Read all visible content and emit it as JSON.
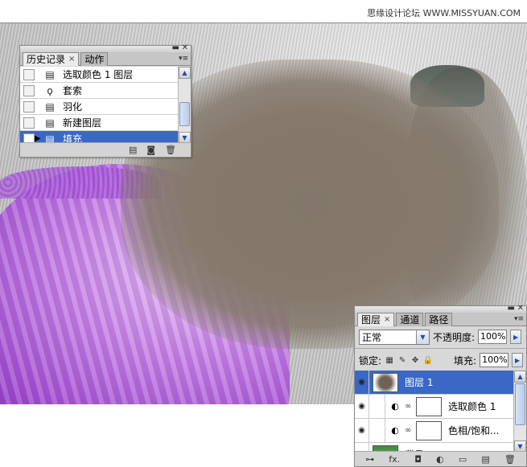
{
  "watermark": {
    "text": "思缘设计论坛 WWW.MISSYUAN.COM"
  },
  "history_panel": {
    "tabs": [
      {
        "label": "历史记录",
        "close": "×",
        "active": true
      },
      {
        "label": "动作",
        "active": false
      }
    ],
    "items": [
      {
        "label": "选取颜色 1 图层",
        "icon": "adjustment-layer-icon",
        "selected": false
      },
      {
        "label": "套索",
        "icon": "lasso-icon",
        "selected": false
      },
      {
        "label": "羽化",
        "icon": "feather-icon",
        "selected": false
      },
      {
        "label": "新建图层",
        "icon": "new-layer-icon",
        "selected": false
      },
      {
        "label": "填充",
        "icon": "fill-icon",
        "selected": true
      }
    ],
    "footer_icons": [
      "new-document-from-state-icon",
      "snapshot-camera-icon",
      "trash-icon"
    ]
  },
  "layers_panel": {
    "tabs": [
      {
        "label": "图层",
        "close": "×",
        "active": true
      },
      {
        "label": "通道",
        "active": false
      },
      {
        "label": "路径",
        "active": false
      }
    ],
    "blend_mode": "正常",
    "opacity_label": "不透明度:",
    "opacity_value": "100%",
    "lock_label": "锁定:",
    "fill_label": "填充:",
    "fill_value": "100%",
    "layers": [
      {
        "name": "图层 1",
        "thumb": "fill",
        "selected": true
      },
      {
        "name": "选取颜色 1",
        "thumb": "white",
        "selected": false
      },
      {
        "name": "色相/饱和...",
        "thumb": "white",
        "selected": false
      },
      {
        "name": "背景",
        "thumb": "green",
        "selected": false
      }
    ],
    "footer_icons": [
      "link-icon",
      "fx-icon",
      "mask-icon",
      "adjustment-icon",
      "folder-icon",
      "new-layer-icon",
      "trash-icon"
    ],
    "fx_label": "fx."
  }
}
